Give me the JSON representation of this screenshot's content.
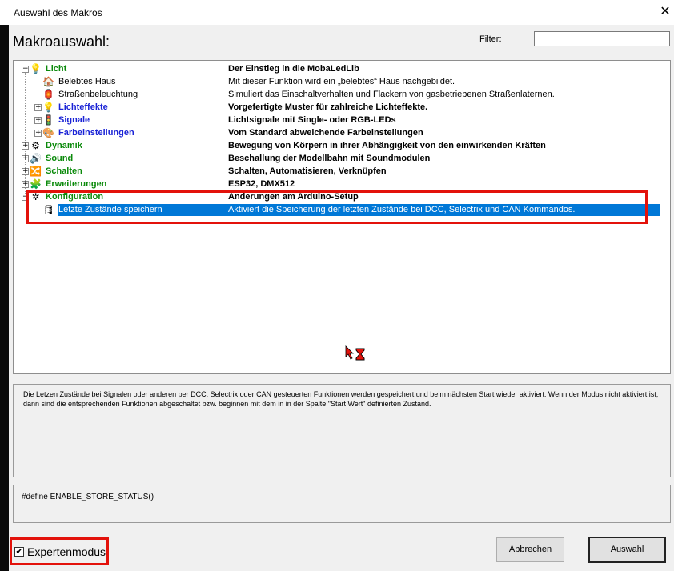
{
  "window": {
    "title": "Auswahl des Makros",
    "close_glyph": "✕"
  },
  "heading": "Makroauswahl:",
  "filter": {
    "label": "Filter:",
    "value": ""
  },
  "tree": {
    "rows": [
      {
        "expander": "−",
        "icon": "💡",
        "name": "Licht",
        "desc": "Der Einstieg in die MobaLedLib",
        "color": "green",
        "category": true,
        "selected": false,
        "icon_name": "light-bulb-icon"
      },
      {
        "expander": "",
        "icon": "🏠",
        "name": "Belebtes Haus",
        "desc": "Mit dieser Funktion wird ein „belebtes“ Haus nachgebildet.",
        "color": "black",
        "category": false,
        "selected": false,
        "icon_name": "house-icon"
      },
      {
        "expander": "",
        "icon": "🏮",
        "name": "Straßenbeleuchtung",
        "desc": "Simuliert das Einschaltverhalten und Flackern von gasbetriebenen Straßenlaternen.",
        "color": "black",
        "category": false,
        "selected": false,
        "icon_name": "street-lamp-icon"
      },
      {
        "expander": "+",
        "icon": "💡",
        "name": "Lichteffekte",
        "desc": "Vorgefertigte Muster für zahlreiche Lichteffekte.",
        "color": "blue",
        "category": true,
        "selected": false,
        "icon_name": "light-bulb-icon"
      },
      {
        "expander": "+",
        "icon": "🚦",
        "name": "Signale",
        "desc": "Lichtsignale mit Single- oder RGB-LEDs",
        "color": "blue",
        "category": true,
        "selected": false,
        "icon_name": "signal-icon"
      },
      {
        "expander": "+",
        "icon": "🎨",
        "name": "Farbeinstellungen",
        "desc": "Vom Standard abweichende Farbeinstellungen",
        "color": "blue",
        "category": true,
        "selected": false,
        "icon_name": "color-wheel-icon"
      },
      {
        "expander": "+",
        "icon": "⚙",
        "name": "Dynamik",
        "desc": "Bewegung von Körpern in ihrer Abhängigkeit von den einwirkenden Kräften",
        "color": "green",
        "category": true,
        "selected": false,
        "icon_name": "gear-icon"
      },
      {
        "expander": "+",
        "icon": "🔊",
        "name": "Sound",
        "desc": "Beschallung der Modellbahn mit Soundmodulen",
        "color": "green",
        "category": true,
        "selected": false,
        "icon_name": "speaker-icon"
      },
      {
        "expander": "+",
        "icon": "🔀",
        "name": "Schalten",
        "desc": "Schalten, Automatisieren, Verknüpfen",
        "color": "green",
        "category": true,
        "selected": false,
        "icon_name": "switch-icon"
      },
      {
        "expander": "+",
        "icon": "🧩",
        "name": "Erweiterungen",
        "desc": "ESP32, DMX512",
        "color": "green",
        "category": true,
        "selected": false,
        "icon_name": "puzzle-icon"
      },
      {
        "expander": "−",
        "icon": "✲",
        "name": "Konfiguration",
        "desc": "Änderungen am Arduino-Setup",
        "color": "green",
        "category": true,
        "selected": false,
        "icon_name": "config-icon"
      },
      {
        "expander": "",
        "icon": "🛢",
        "name": "Letzte Zustände speichern",
        "desc": "Aktiviert die Speicherung der letzten Zustände bei DCC, Selectrix und CAN Kommandos.",
        "color": "black",
        "category": false,
        "selected": true,
        "icon_name": "database-icon"
      }
    ]
  },
  "description": "Die Letzen Zustände bei Signalen oder anderen per DCC, Selectrix oder CAN gesteuerten Funktionen werden gespeichert und beim nächsten Start wieder aktiviert. Wenn der Modus nicht aktiviert ist, dann sind die entsprechenden Funktionen abgeschaltet bzw. beginnen mit dem in in der Spalte \"Start Wert\" definierten Zustand.",
  "code": "#define ENABLE_STORE_STATUS()",
  "expert_mode": {
    "label": "Expertenmodus",
    "checked": true,
    "check_glyph": "✔"
  },
  "buttons": {
    "cancel": "Abbrechen",
    "ok": "Auswahl"
  },
  "colors": {
    "selection": "#0078d7",
    "green": "#0b8a0b",
    "blue": "#1a23d6",
    "highlight_red": "#e3120b"
  }
}
